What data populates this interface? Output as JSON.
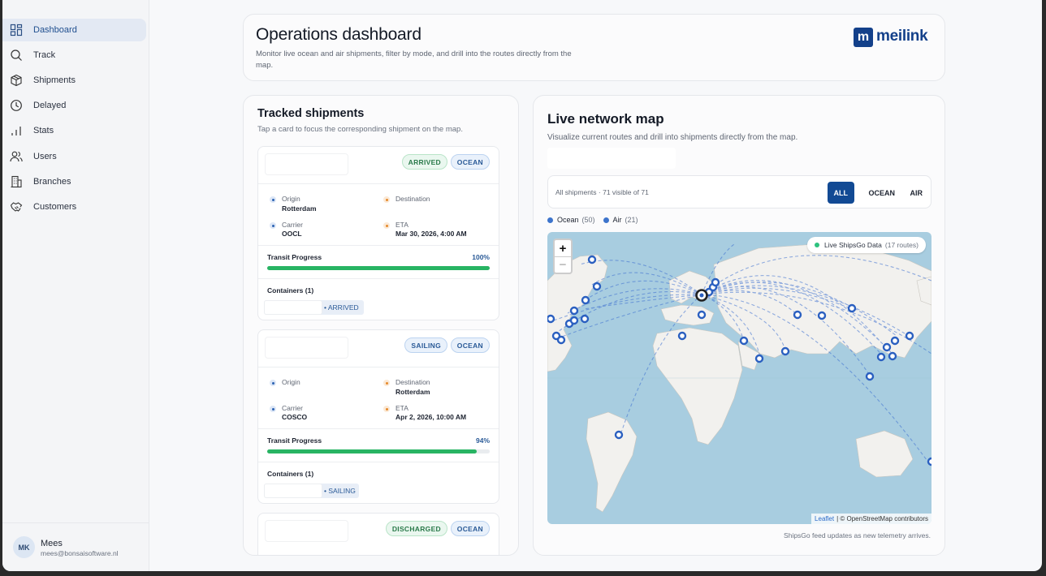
{
  "colors": {
    "accent": "#124a94",
    "success": "#28b463",
    "ocean": "#3d74cc"
  },
  "sidebar": {
    "items": [
      {
        "label": "Dashboard",
        "icon": "dashboard-icon",
        "active": true
      },
      {
        "label": "Track",
        "icon": "search-icon"
      },
      {
        "label": "Shipments",
        "icon": "box-icon"
      },
      {
        "label": "Delayed",
        "icon": "clock-icon"
      },
      {
        "label": "Stats",
        "icon": "bar-chart-icon"
      },
      {
        "label": "Users",
        "icon": "users-icon"
      },
      {
        "label": "Branches",
        "icon": "building-icon"
      },
      {
        "label": "Customers",
        "icon": "handshake-icon"
      }
    ],
    "user": {
      "initials": "MK",
      "name": "Mees",
      "email": "mees@bonsaisoftware.nl"
    }
  },
  "header": {
    "title": "Operations dashboard",
    "subtitle": "Monitor live ocean and air shipments, filter by mode, and drill into the routes directly from the map.",
    "logo_mark": "m",
    "logo_text": "meilink"
  },
  "tracked": {
    "title": "Tracked shipments",
    "subtitle": "Tap a card to focus the corresponding shipment on the map.",
    "origin_label": "Origin",
    "destination_label": "Destination",
    "carrier_label": "Carrier",
    "eta_label": "ETA",
    "progress_label": "Transit Progress",
    "containers_label": "Containers (1)",
    "shipments": [
      {
        "status": "ARRIVED",
        "mode": "OCEAN",
        "origin": "Rotterdam",
        "destination": "",
        "carrier": "OOCL",
        "eta": "Mar 30, 2026, 4:00 AM",
        "progress_text": "100%",
        "progress": 1.0,
        "container_status": "• ARRIVED"
      },
      {
        "status": "SAILING",
        "mode": "OCEAN",
        "origin": "",
        "destination": "Rotterdam",
        "carrier": "COSCO",
        "eta": "Apr 2, 2026, 10:00 AM",
        "progress_text": "94%",
        "progress": 0.94,
        "container_status": "• SAILING"
      },
      {
        "status": "DISCHARGED",
        "mode": "OCEAN"
      }
    ]
  },
  "map": {
    "title": "Live network map",
    "subtitle": "Visualize current routes and drill into shipments directly from the map.",
    "filter_info": "All shipments · 71 visible of 71",
    "filters": [
      "ALL",
      "OCEAN",
      "AIR"
    ],
    "active_filter": "ALL",
    "legend": [
      {
        "label": "Ocean",
        "count": "(50)"
      },
      {
        "label": "Air",
        "count": "(21)"
      }
    ],
    "zoom_in": "+",
    "zoom_out": "−",
    "live_label": "Live ShipsGo Data",
    "live_count": "(17 routes)",
    "attribution_leaflet": "Leaflet",
    "attribution_rest": "| © OpenStreetMap contributors",
    "feed_note": "ShipsGo feed updates as new telemetry arrives."
  }
}
